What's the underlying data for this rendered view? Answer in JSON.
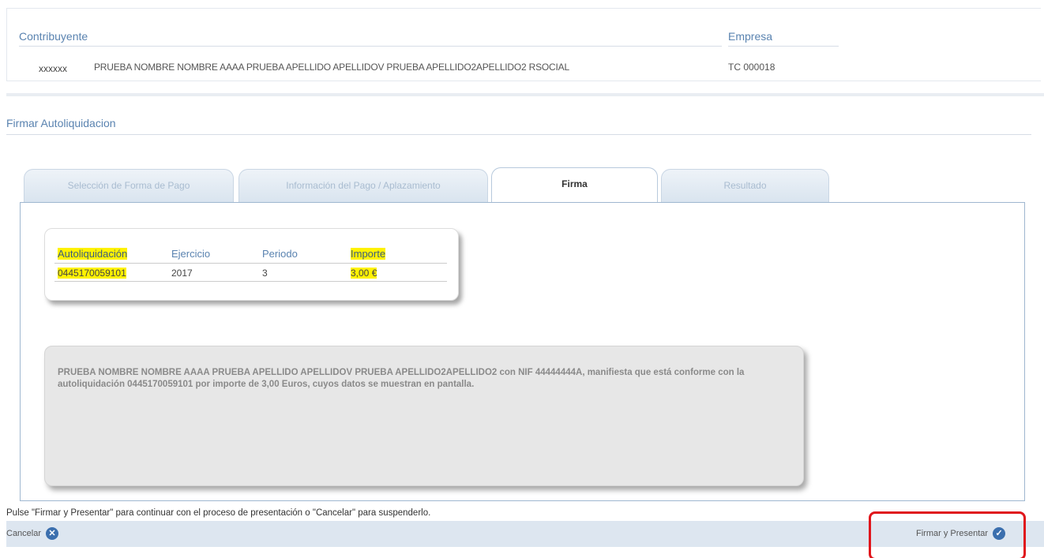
{
  "contributor": {
    "label": "Contribuyente",
    "id": "xxxxxx",
    "name": "PRUEBA NOMBRE NOMBRE AAAA PRUEBA APELLIDO APELLIDOV PRUEBA APELLIDO2APELLIDO2 RSOCIAL",
    "company_label": "Empresa",
    "company_value": "TC  000018"
  },
  "section": {
    "title": "Firmar Autoliquidacion"
  },
  "tabs": [
    {
      "label": "Selección de Forma de Pago",
      "active": false
    },
    {
      "label": "Información del Pago / Aplazamiento",
      "active": false
    },
    {
      "label": "Firma",
      "active": true
    },
    {
      "label": "Resultado",
      "active": false
    }
  ],
  "summary": {
    "headers": [
      "Autoliquidación",
      "Ejercicio",
      "Periodo",
      "Importe"
    ],
    "row": [
      "0445170059101",
      "2017",
      "3",
      "3,00 €"
    ]
  },
  "statement": "PRUEBA NOMBRE NOMBRE AAAA PRUEBA APELLIDO APELLIDOV PRUEBA APELLIDO2APELLIDO2 con NIF 44444444A, manifiesta que está conforme con la autoliquidación 0445170059101 por importe de 3,00 Euros, cuyos datos se muestran en pantalla.",
  "instructions": "Pulse \"Firmar y Presentar\" para continuar con el proceso de presentación o \"Cancelar\" para suspenderlo.",
  "buttons": {
    "cancel_label": "Cancelar",
    "cancel_icon": "close-circle-icon",
    "submit_label": "Firmar y Presentar",
    "submit_icon": "check-circle-icon"
  },
  "colors": {
    "accent": "#5a83b0",
    "highlight": "#fff200",
    "annotation": "#e0161c"
  }
}
